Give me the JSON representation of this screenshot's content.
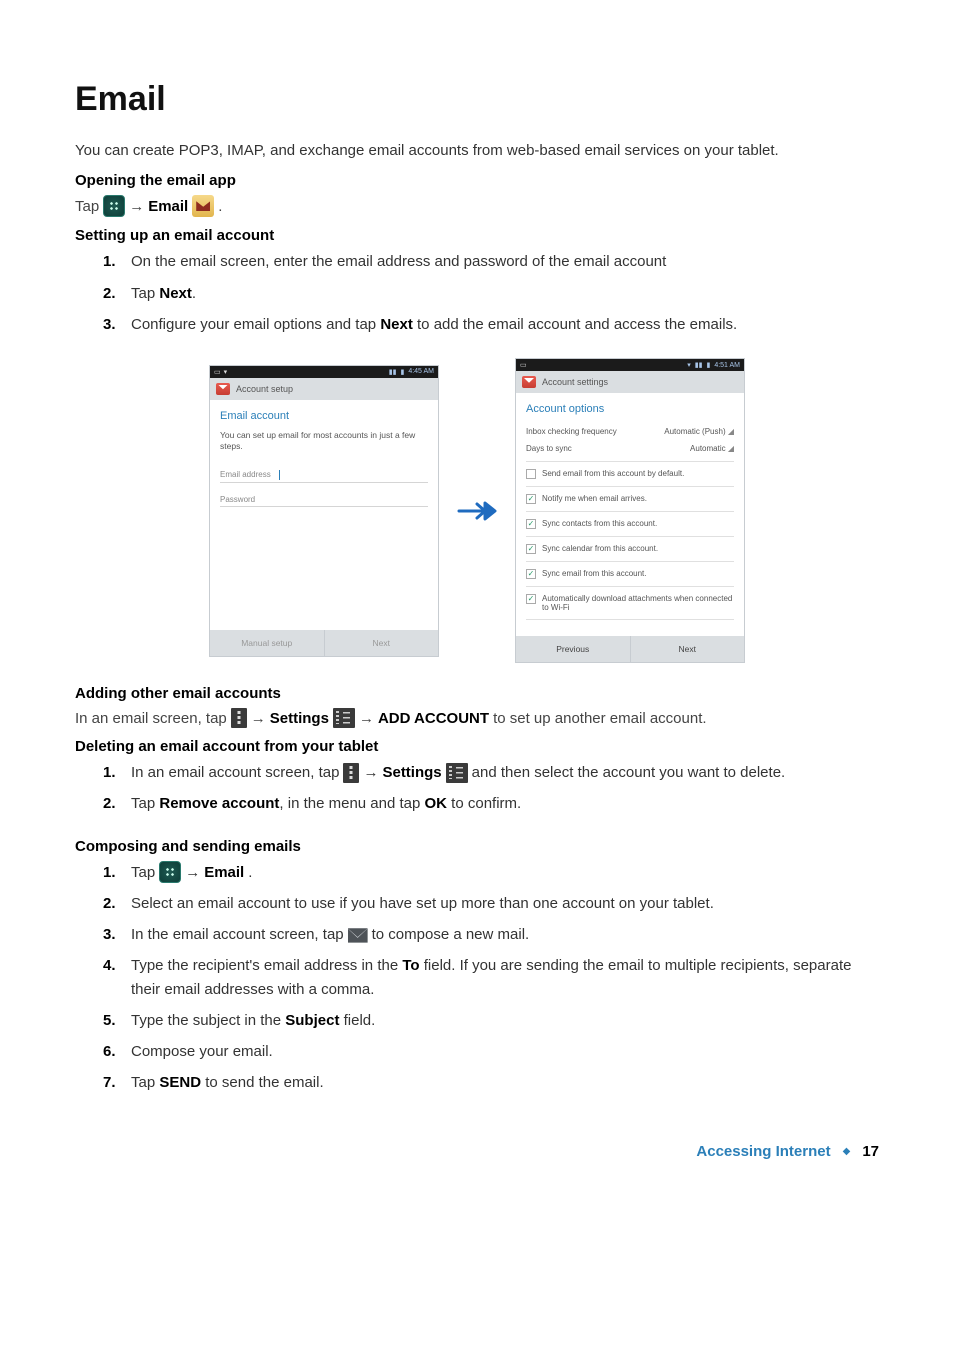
{
  "heading": "Email",
  "intro": "You can create POP3, IMAP, and exchange email accounts from web-based email services on your tablet.",
  "opening": {
    "title": "Opening the email app",
    "prefix": "Tap",
    "arrow": "→",
    "email_word": "Email",
    "period": "."
  },
  "setting_up": {
    "title": "Setting up an email account",
    "steps": [
      "On the email screen, enter the email address and password of the email account",
      {
        "prefix": "Tap ",
        "bold": "Next",
        "suffix": "."
      },
      {
        "prefix": "Configure your email options and tap ",
        "bold": "Next",
        "suffix": " to add the email account and access the emails."
      }
    ]
  },
  "figure": {
    "left": {
      "status_time": "4:45 AM",
      "appbar_title": "Account setup",
      "body_title": "Email account",
      "body_desc": "You can set up email for most accounts in just a few steps.",
      "field_email": "Email address",
      "field_password": "Password",
      "btn_left": "Manual setup",
      "btn_right": "Next"
    },
    "right": {
      "status_time": "4:51 AM",
      "appbar_title": "Account settings",
      "body_title": "Account options",
      "rows": {
        "freq_label": "Inbox checking frequency",
        "freq_value": "Automatic (Push)",
        "days_label": "Days to sync",
        "days_value": "Automatic"
      },
      "checks": [
        {
          "checked": false,
          "label": "Send email from this account by default."
        },
        {
          "checked": true,
          "label": "Notify me when email arrives."
        },
        {
          "checked": true,
          "label": "Sync contacts from this account."
        },
        {
          "checked": true,
          "label": "Sync calendar from this account."
        },
        {
          "checked": true,
          "label": "Sync email from this account."
        },
        {
          "checked": true,
          "label": "Automatically download attachments when connected to Wi-Fi"
        }
      ],
      "btn_left": "Previous",
      "btn_right": "Next"
    }
  },
  "adding": {
    "title": "Adding other email accounts",
    "prefix": "In an email screen, tap",
    "arrow": "→",
    "settings": "Settings",
    "add_account": "ADD ACCOUNT",
    "suffix": "to set up another email account."
  },
  "deleting": {
    "title": "Deleting an email account from your tablet",
    "s1_prefix": "In an email account screen, tap",
    "arrow": "→",
    "settings": "Settings",
    "s1_suffix": "and then select the account you want to delete.",
    "s2_prefix": "Tap ",
    "s2_bold1": "Remove account",
    "s2_mid": ", in the menu and tap ",
    "s2_bold2": "OK",
    "s2_suffix": " to confirm."
  },
  "composing": {
    "title": "Composing and sending emails",
    "s1_prefix": "Tap",
    "s1_arrow": "→",
    "s1_email": "Email",
    "s1_suffix": ".",
    "s2": "Select an email account to use if you have set up more than one account on your tablet.",
    "s3_prefix": "In the email account screen, tap",
    "s3_suffix": "to compose a new mail.",
    "s4_prefix": "Type the recipient's email address in the ",
    "s4_bold": "To",
    "s4_suffix": " field. If you are sending the email to multiple recipients, separate their email addresses with a comma.",
    "s5_prefix": "Type the subject in the ",
    "s5_bold": "Subject",
    "s5_suffix": " field.",
    "s6": "Compose your email.",
    "s7_prefix": "Tap ",
    "s7_bold": "SEND",
    "s7_suffix": " to send the email."
  },
  "footer": {
    "section": "Accessing Internet",
    "page": "17"
  }
}
